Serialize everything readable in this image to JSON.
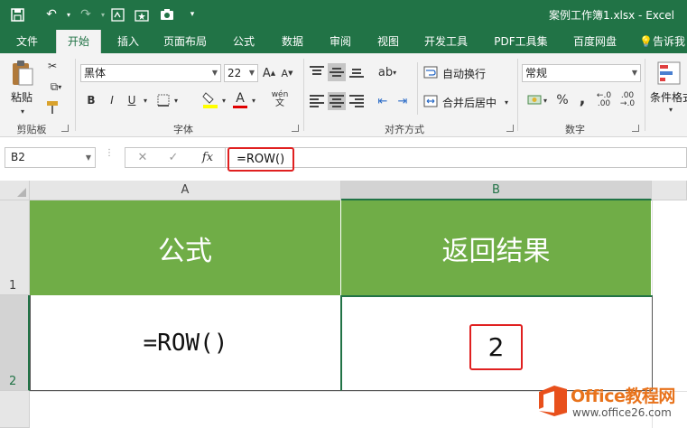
{
  "titlebar": {
    "title": "案例工作簿1.xlsx - Excel",
    "bg_color": "#217346"
  },
  "tabs": [
    {
      "label": "文件"
    },
    {
      "label": "开始",
      "active": true
    },
    {
      "label": "插入"
    },
    {
      "label": "页面布局"
    },
    {
      "label": "公式"
    },
    {
      "label": "数据"
    },
    {
      "label": "审阅"
    },
    {
      "label": "视图"
    },
    {
      "label": "开发工具"
    },
    {
      "label": "PDF工具集"
    },
    {
      "label": "百度网盘"
    },
    {
      "label": "告诉我"
    }
  ],
  "ribbon": {
    "clipboard": {
      "paste_label": "粘贴",
      "group_label": "剪贴板"
    },
    "font": {
      "font_name": "黑体",
      "font_size": "22",
      "group_label": "字体",
      "bold": "B",
      "italic": "I",
      "underline": "U",
      "font_color_glyph": "A",
      "phonetic_glyph": "wén"
    },
    "alignment": {
      "wrap_label": "自动换行",
      "merge_label": "合并后居中",
      "group_label": "对齐方式"
    },
    "number": {
      "format": "常规",
      "group_label": "数字",
      "percent": "%",
      "comma": ","
    },
    "styles": {
      "conditional_label": "条件格式"
    }
  },
  "formula_bar": {
    "name_box": "B2",
    "cancel": "✕",
    "enter": "✓",
    "fx": "fx",
    "formula": "=ROW()"
  },
  "sheet": {
    "columns": [
      "A",
      "B"
    ],
    "rows": [
      "1",
      "2"
    ],
    "cells": {
      "A1": "公式",
      "B1": "返回结果",
      "A2": "=ROW()",
      "B2": "2"
    },
    "header_fill": "#70ad47",
    "highlight_color": "#e02020"
  },
  "watermark": {
    "name": "Office教程网",
    "url": "www.office26.com"
  }
}
